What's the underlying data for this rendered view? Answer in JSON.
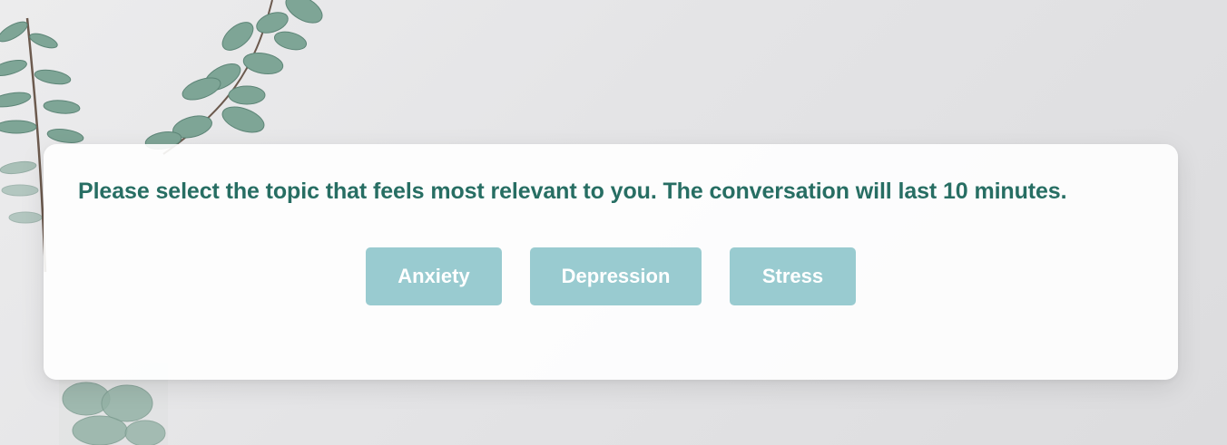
{
  "dialog": {
    "prompt": "Please select the topic that feels most relevant to you. The conversation will last 10 minutes."
  },
  "topics": [
    {
      "label": "Anxiety"
    },
    {
      "label": "Depression"
    },
    {
      "label": "Stress"
    }
  ],
  "colors": {
    "accent_text": "#276e63",
    "button_bg": "#99cbd0",
    "button_text": "#ffffff",
    "leaf": "#6f9a8a"
  }
}
